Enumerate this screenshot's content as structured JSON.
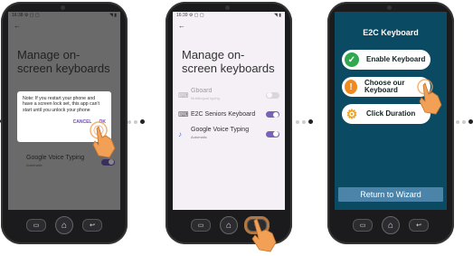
{
  "colors": {
    "phone": "#1b1b1d",
    "screen_light": "#eeeeee",
    "dialog_bg": "#ffffff",
    "accent_purple": "#7a62b8",
    "e2c_bg": "#0b4a63",
    "green": "#2fa84f",
    "orange": "#f08a1e",
    "hand": "#f2a055"
  },
  "phone1": {
    "status_time": "16:38",
    "status_icons": "⚙ ▢ ▢",
    "status_right": "◥ ▮",
    "back_icon": "←",
    "title": "Manage on-screen keyboards",
    "dialog_text": "Note: If you restart your phone and have a screen lock set, this app can't start until you unlock your phone",
    "dialog_cancel": "CANCEL",
    "dialog_ok": "OK",
    "row_label": "Google Voice Typing",
    "row_sub": "Automatic"
  },
  "phone2": {
    "status_time": "16:39",
    "status_icons": "⚙ ▢ ▢",
    "status_right": "◥ ▮",
    "back_icon": "←",
    "title": "Manage on-screen keyboards",
    "rows": [
      {
        "label": "Gboard",
        "sub": "Multilingual typing",
        "on": false,
        "disabled": true
      },
      {
        "label": "E2C Seniors Keyboard",
        "sub": "",
        "on": true,
        "disabled": false
      },
      {
        "label": "Google Voice Typing",
        "sub": "Automatic",
        "on": true,
        "disabled": false
      }
    ]
  },
  "phone3": {
    "header": "E2C Keyboard",
    "buttons": [
      {
        "label": "Enable Keyboard",
        "icon": "check-icon",
        "glyph": "✓"
      },
      {
        "label": "Choose our Keyboard",
        "icon": "alert-icon",
        "glyph": "!"
      },
      {
        "label": "Click Duration",
        "icon": "gears-icon",
        "glyph": "⚙"
      }
    ],
    "footer_button": "Return to Wizard"
  },
  "nav": {
    "recents_glyph": "▭",
    "home_glyph": "⌂",
    "back_glyph": "↩"
  }
}
